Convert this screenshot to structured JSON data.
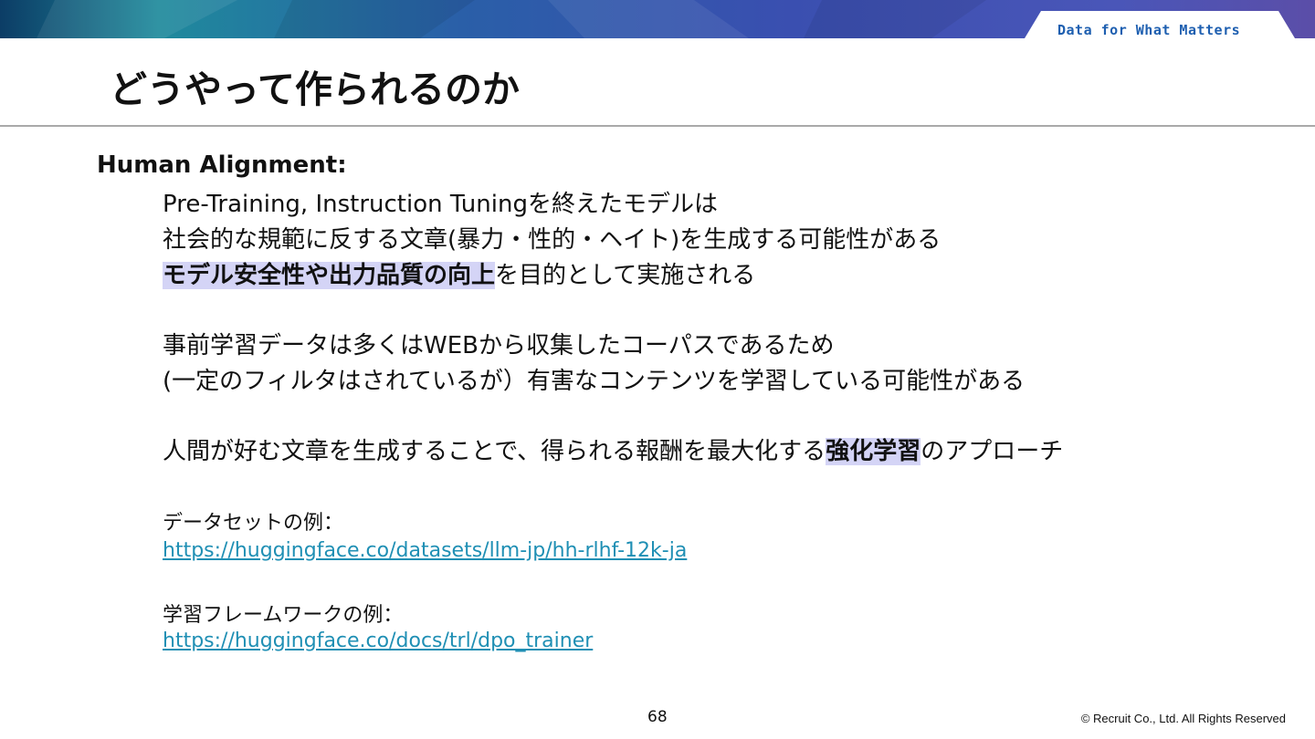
{
  "header": {
    "tagline": "Data for What Matters",
    "colors": {
      "banner_dark": "#0c3d66",
      "banner_teal": "#1f8a9c",
      "banner_blue": "#3a4fb0",
      "banner_purple": "#5b4ea8"
    }
  },
  "slide": {
    "title": "どうやって作られるのか",
    "section_heading": "Human Alignment:",
    "lines": [
      "Pre-Training, Instruction Tuningを終えたモデルは",
      "社会的な規範に反する文章(暴力・性的・ヘイト)を生成する可能性がある"
    ],
    "line3": {
      "highlight": "モデル安全性や出力品質の向上",
      "rest": "を目的として実施される"
    },
    "line4": "事前学習データは多くはWEBから収集したコーパスであるため",
    "line5": "(一定のフィルタはされているが）有害なコンテンツを学習している可能性がある",
    "line6": {
      "before": "人間が好む文章を生成することで、得られる報酬を最大化する",
      "highlight": "強化学習",
      "after": "のアプローチ"
    },
    "dataset_example_label": "データセットの例：",
    "dataset_example_link": "https://huggingface.co/datasets/llm-jp/hh-rlhf-12k-ja",
    "framework_example_label": "学習フレームワークの例：",
    "framework_example_link": "https://huggingface.co/docs/trl/dpo_trainer",
    "highlight_color": "#d4d4f6",
    "link_color": "#1f8fb4"
  },
  "footer": {
    "page_number": "68",
    "copyright": "© Recruit Co., Ltd. All Rights Reserved"
  }
}
